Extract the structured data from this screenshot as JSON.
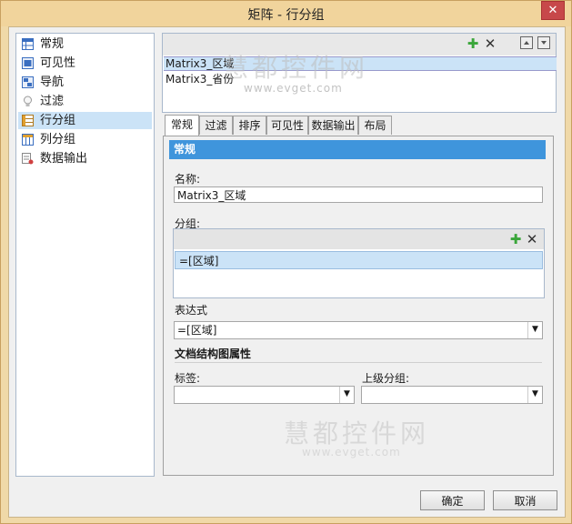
{
  "window": {
    "title": "矩阵 - 行分组",
    "close": "✕"
  },
  "sidebar": {
    "items": [
      {
        "label": "常规"
      },
      {
        "label": "可见性"
      },
      {
        "label": "导航"
      },
      {
        "label": "过滤"
      },
      {
        "label": "行分组",
        "selected": true
      },
      {
        "label": "列分组"
      },
      {
        "label": "数据输出"
      }
    ]
  },
  "group_list": {
    "items": [
      "Matrix3_区域",
      "Matrix3_省份"
    ],
    "selected_index": 0
  },
  "tabs": [
    "常规",
    "过滤",
    "排序",
    "可见性",
    "数据输出",
    "布局"
  ],
  "active_tab": 0,
  "general": {
    "section_title": "常规",
    "name_label": "名称:",
    "name_value": "Matrix3_区域",
    "group_label": "分组:",
    "group_items": [
      "=[区域]"
    ],
    "expression_label": "表达式",
    "expression_value": "=[区域]",
    "doc_map_title": "文档结构图属性",
    "tag_label": "标签:",
    "tag_value": "",
    "parent_group_label": "上级分组:",
    "parent_group_value": ""
  },
  "buttons": {
    "ok": "确定",
    "cancel": "取消"
  },
  "watermark": {
    "text": "慧都控件网",
    "url": "www.evget.com"
  },
  "colors": {
    "accent": "#3f95dc",
    "selection": "#cbe3f7",
    "add_green": "#3aa63a"
  }
}
